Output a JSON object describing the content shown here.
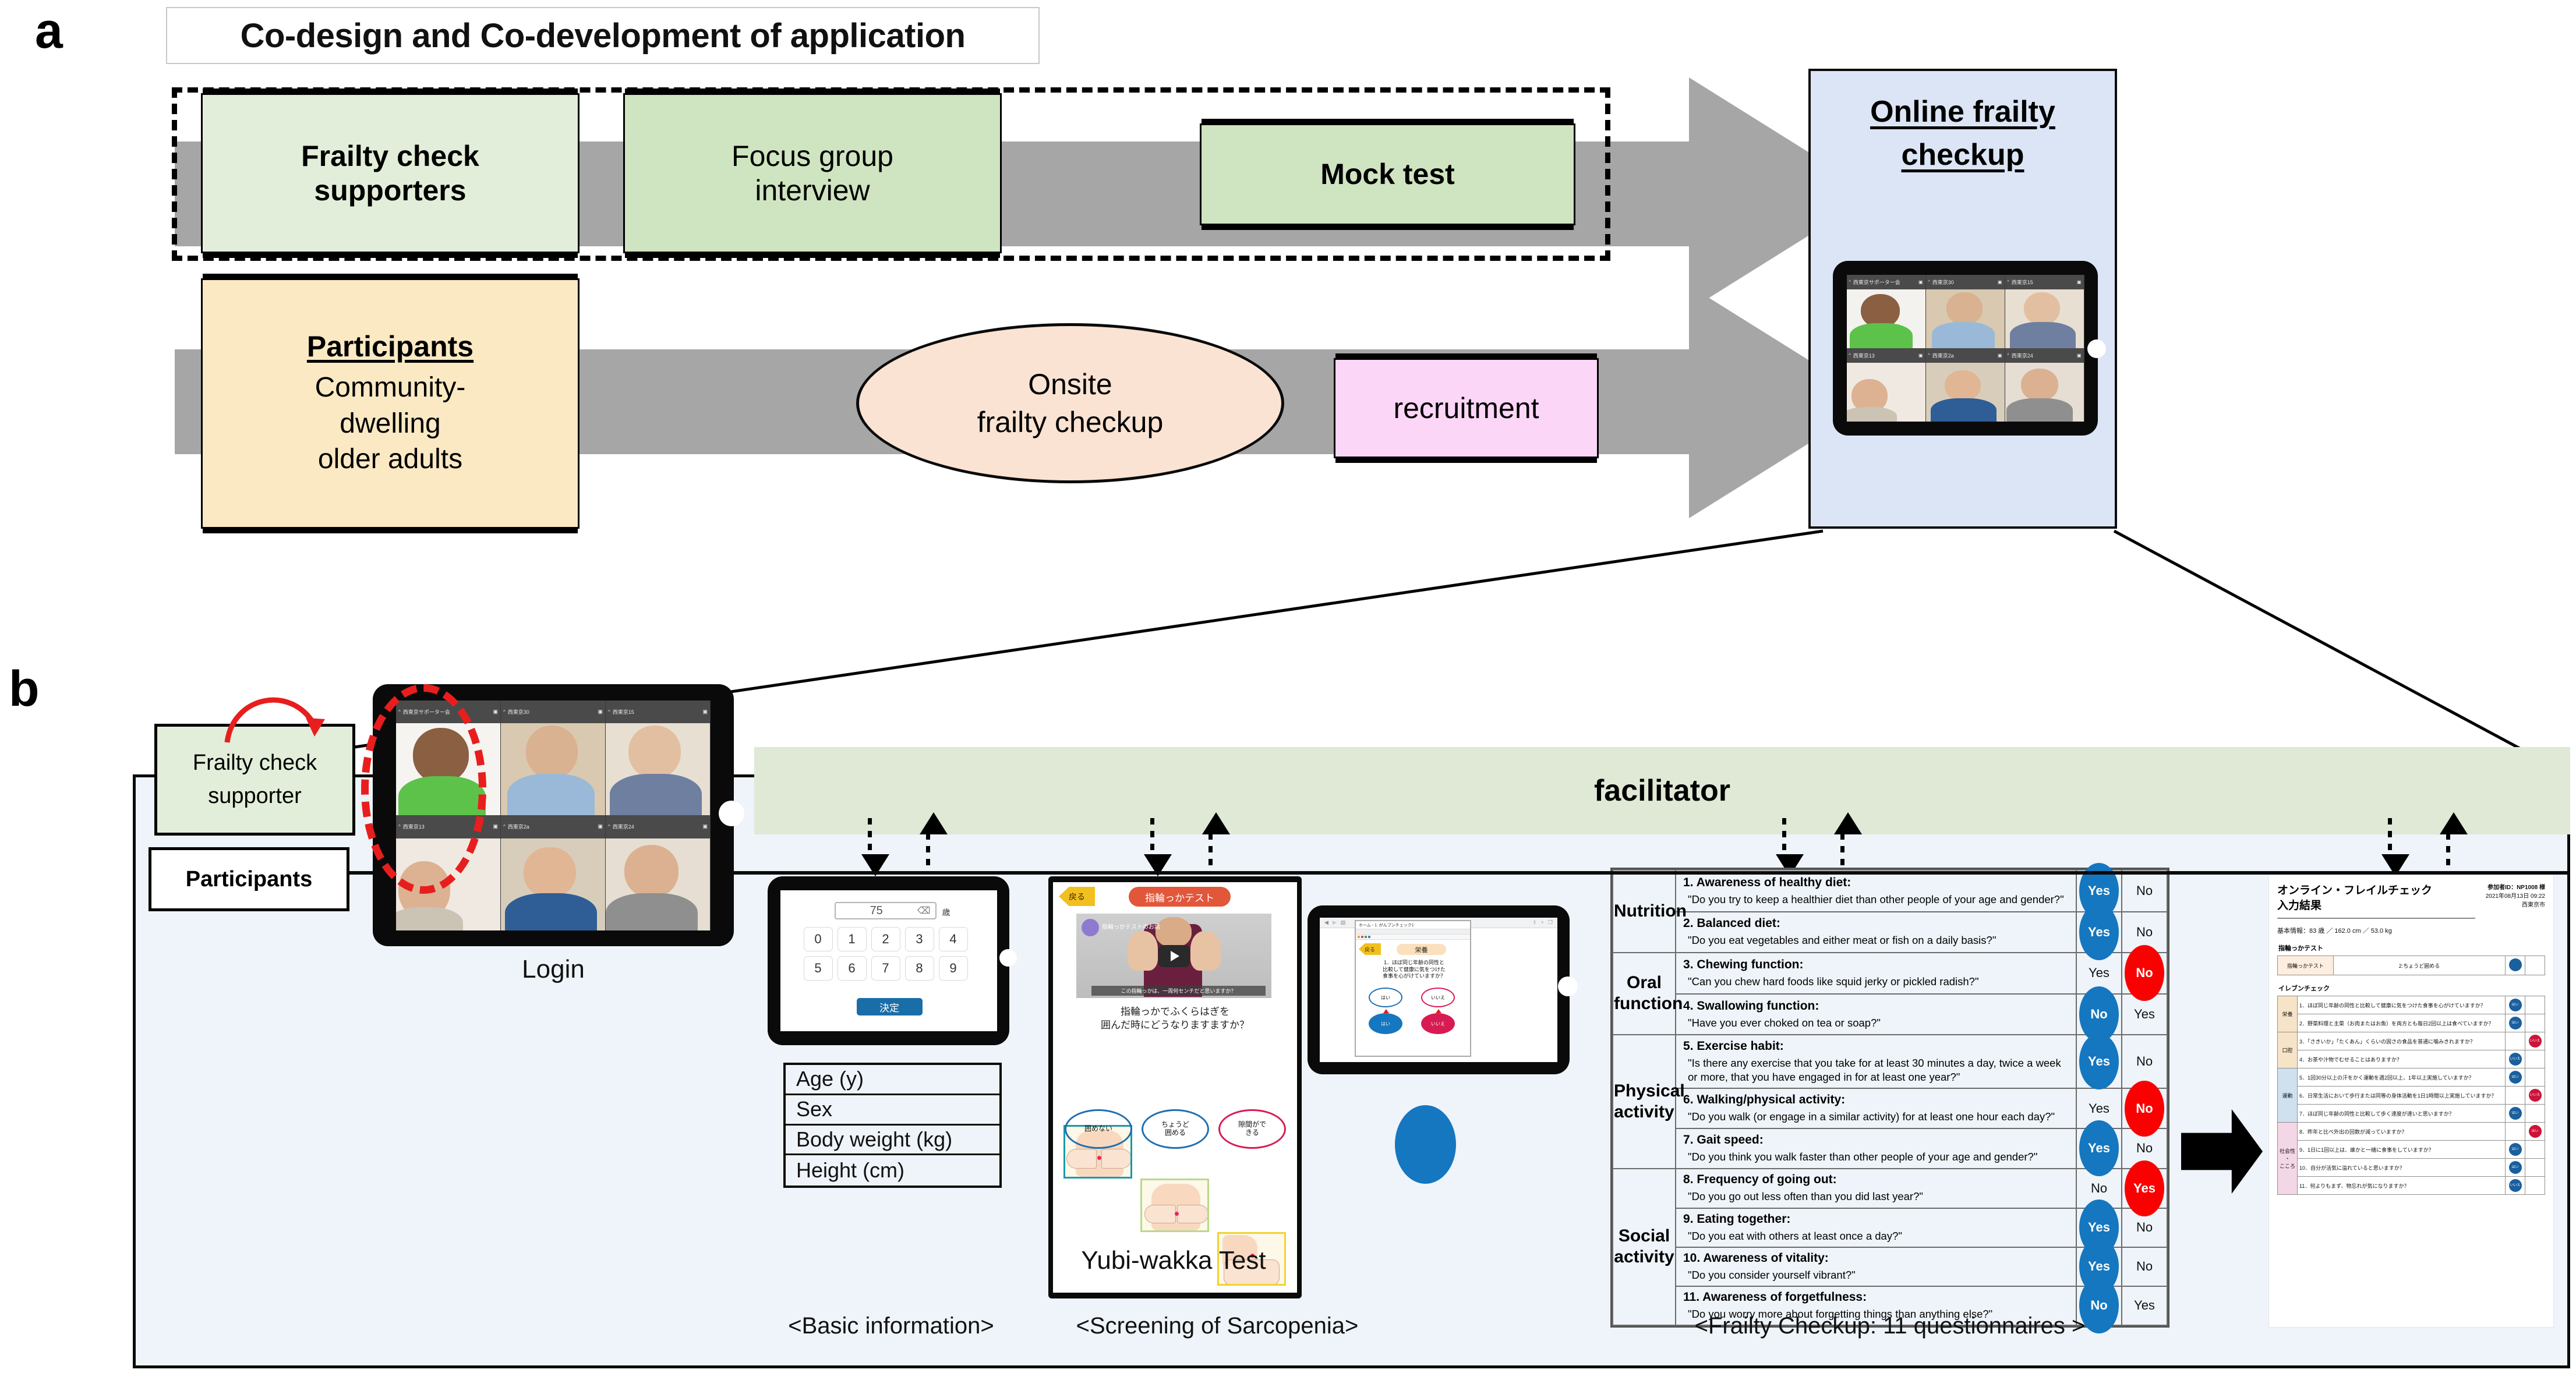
{
  "panels": {
    "a_letter": "a",
    "b_letter": "b"
  },
  "panel_a": {
    "title": "Co-design and Co-development of application",
    "supporter_track": [
      {
        "label": "Frailty check\nsupporters",
        "bold": true,
        "fill": "#e2eed9"
      },
      {
        "label": "Focus group\ninterview",
        "bold": false,
        "fill": "#cfe4c0"
      },
      {
        "label": "Mock test",
        "bold": true,
        "fill": "#cfe4c0"
      }
    ],
    "participant_track": {
      "box_title": "Participants",
      "box_sub": "Community-\ndwelling\nolder adults",
      "box_fill": "#fbe9c3",
      "oval_label": "Onsite\nfrailty checkup",
      "oval_fill": "#fae3d3",
      "recruitment_label": "recruitment",
      "recruitment_fill": "#fcd6f7"
    },
    "outcome": {
      "title": "Online frailty\ncheckup",
      "fill": "#dbe5f5"
    }
  },
  "panel_b": {
    "facilitator_label": "facilitator",
    "supporter_tag": "Frailty check\nsupporter",
    "participants_tag": "Participants",
    "stages": [
      {
        "name": "login",
        "label": "Login",
        "caption": ""
      },
      {
        "name": "basic-info",
        "label": "",
        "caption": "<Basic information>"
      },
      {
        "name": "yubi-wakka",
        "label": "Yubi-wakka  Test",
        "caption": "<Screening of Sarcopenia>"
      },
      {
        "name": "frailty-q",
        "label": "",
        "caption": "<Frailty Checkup: 11 questionnaires >"
      }
    ],
    "basic_info_rows": [
      "Age (y)",
      "Sex",
      "Body weight (kg)",
      "Height (cm)"
    ],
    "keypad": {
      "value": "75",
      "unit": "歳",
      "keys": [
        "0",
        "1",
        "2",
        "3",
        "4",
        "5",
        "6",
        "7",
        "8",
        "9"
      ],
      "submit": "決定",
      "backspace_icon": "backspace-icon"
    },
    "yubi_wakka_screen": {
      "back_label": "戻る",
      "pill_label": "指輪っかテスト",
      "video_caption": "この指輪っかは、一周何センチだと思いますか？",
      "video_overlay_title": "指輪っかテストのお話",
      "question": "指輪っかでふくらはぎを\n囲んだ時にどうなりますますか？",
      "options": [
        {
          "label": "囲めない",
          "color": "#1f6fb2",
          "img_border": "#1a9aa8"
        },
        {
          "label": "ちょうど\n囲める",
          "color": "#1f6fb2",
          "img_border": "#b8d98a"
        },
        {
          "label": "隙間がで\nきる",
          "color": "#d81b52",
          "img_border": "#f2d231"
        }
      ],
      "play_icon": "play-button-icon"
    },
    "nutrition_screen": {
      "tab_title": "ホーム - 1. がんプンチェック1",
      "back_label": "戻る",
      "pill_label": "栄養",
      "question": "1．ほぼ同じ年齢の同性と\n比較して健康に気をつけた\n食事を心がけていますか？",
      "options_outline": [
        {
          "label": "はい",
          "color": "#1f6fb2"
        },
        {
          "label": "いいえ",
          "color": "#d81b52"
        }
      ],
      "options_filled": [
        {
          "label": "はい",
          "color": "#1577bf"
        },
        {
          "label": "いいえ",
          "color": "#d81b52"
        }
      ]
    },
    "zoom_tile_names": [
      "西東京サポーター会",
      "西東京30",
      "西東京15",
      "西東京13",
      "西東京2a",
      "西東京24"
    ],
    "questionnaire": {
      "domains": [
        {
          "name": "Nutrition",
          "rows": 2,
          "items": [
            {
              "n": "1",
              "title": "Awareness of healthy diet:",
              "text": "\"Do you try to keep a healthier diet than other people of your age and gender?\"",
              "left": "Yes",
              "right": "No",
              "selected": "left",
              "selected_color": "blue"
            },
            {
              "n": "2",
              "title": "Balanced diet:",
              "text": "\"Do you eat vegetables and either meat or fish on a daily basis?\"",
              "left": "Yes",
              "right": "No",
              "selected": "left",
              "selected_color": "blue"
            }
          ]
        },
        {
          "name": "Oral function",
          "rows": 2,
          "items": [
            {
              "n": "3",
              "title": "Chewing function:",
              "text": "\"Can you chew hard foods like squid jerky or pickled radish?\"",
              "left": "Yes",
              "right": "No",
              "selected": "right",
              "selected_color": "red"
            },
            {
              "n": "4",
              "title": "Swallowing function:",
              "text": "\"Have you ever choked on tea or soap?\"",
              "left": "No",
              "right": "Yes",
              "selected": "left",
              "selected_color": "blue"
            }
          ]
        },
        {
          "name": "Physical\nactivity",
          "rows": 3,
          "items": [
            {
              "n": "5",
              "title": "Exercise habit:",
              "text": "\"Is there any exercise that you take for at least 30 minutes a day, twice a week or more, that you have engaged in for at least one year?\"",
              "left": "Yes",
              "right": "No",
              "selected": "left",
              "selected_color": "blue"
            },
            {
              "n": "6",
              "title": "Walking/physical activity:",
              "text": "\"Do you walk (or engage in a similar activity) for at least one hour each day?\"",
              "left": "Yes",
              "right": "No",
              "selected": "right",
              "selected_color": "red"
            },
            {
              "n": "7",
              "title": "Gait speed:",
              "text": "\"Do you think you walk faster than other people of your age and gender?\"",
              "left": "Yes",
              "right": "No",
              "selected": "left",
              "selected_color": "blue"
            }
          ]
        },
        {
          "name": "Social\nactivity",
          "rows": 4,
          "items": [
            {
              "n": "8",
              "title": "Frequency of going out:",
              "text": "\"Do you go out less often than you did last year?\"",
              "left": "No",
              "right": "Yes",
              "selected": "right",
              "selected_color": "red"
            },
            {
              "n": "9",
              "title": "Eating together:",
              "text": "\"Do you eat with others at least once a day?\"",
              "left": "Yes",
              "right": "No",
              "selected": "left",
              "selected_color": "blue"
            },
            {
              "n": "10",
              "title": "Awareness of vitality:",
              "text": "\"Do you consider yourself vibrant?\"",
              "left": "Yes",
              "right": "No",
              "selected": "left",
              "selected_color": "blue"
            },
            {
              "n": "11",
              "title": "Awareness of forgetfulness:",
              "text": "\"Do you worry more about forgetting things than anything else?\"",
              "left": "No",
              "right": "Yes",
              "selected": "left",
              "selected_color": "blue"
            }
          ]
        }
      ]
    },
    "result_sheet": {
      "title": "オンライン・フレイルチェック\n入力結果",
      "participant_id": "参加者ID：NP1008 様",
      "datetime": "2021年08月13日 09:22",
      "place": "西東京市",
      "basic": "基本情報：83 歳 ／ 162.0 cm ／ 53.0 kg",
      "section1_title": "指輪っかテスト",
      "yubi_row": {
        "label": "指輪っかテスト",
        "value": "2:ちょうど囲める",
        "mark": "✓",
        "mark_color": "blue"
      },
      "section2_title": "イレブンチェック",
      "categories": [
        {
          "label": "栄養",
          "fill": "#f7e4c8",
          "span": 2
        },
        {
          "label": "口腔",
          "fill": "#f7e4c8",
          "span": 2
        },
        {
          "label": "運動",
          "fill": "#cfe0ef",
          "span": 3
        },
        {
          "label": "社会性\n・\nこころ",
          "fill": "#f4d7e6",
          "span": 4
        }
      ],
      "rows": [
        {
          "n": "1",
          "text": "ほぼ同じ年齢の同性と比較して健康に気をつけた食事を心がけていますか？",
          "mark": "はい",
          "side": "left",
          "color": "blue"
        },
        {
          "n": "2",
          "text": "野菜料理と主菜（お肉またはお魚）を両方とも毎日2回以上は食べていますか？",
          "mark": "はい",
          "side": "left",
          "color": "blue"
        },
        {
          "n": "3",
          "text": "「さきいか」「たくあん」くらいの固さの食品を普通に噛みきれますか？",
          "mark": "いいえ",
          "side": "right",
          "color": "red"
        },
        {
          "n": "4",
          "text": "お茶や汁物でむせることはありますか？",
          "mark": "いいえ",
          "side": "left",
          "color": "blue"
        },
        {
          "n": "5",
          "text": "1回30分以上の汗をかく運動を週2回以上、1年以上実施していますか？",
          "mark": "はい",
          "side": "left",
          "color": "blue"
        },
        {
          "n": "6",
          "text": "日常生活において歩行または同等の身体活動を1日1時間以上実施していますか？",
          "mark": "いいえ",
          "side": "right",
          "color": "red"
        },
        {
          "n": "7",
          "text": "ほぼ同じ年齢の同性と比較して歩く速度が速いと思いますか？",
          "mark": "はい",
          "side": "left",
          "color": "blue"
        },
        {
          "n": "8",
          "text": "昨年と比べ外出の回数が減っていますか？",
          "mark": "はい",
          "side": "right",
          "color": "red"
        },
        {
          "n": "9",
          "text": "1日に1回以上は、誰かと一緒に食事をしていますか？",
          "mark": "はい",
          "side": "left",
          "color": "blue"
        },
        {
          "n": "10",
          "text": "自分が活気に溢れていると思いますか？",
          "mark": "はい",
          "side": "left",
          "color": "blue"
        },
        {
          "n": "11",
          "text": "何よりもまず、物忘れが気になりますか？",
          "mark": "いいえ",
          "side": "left",
          "color": "blue"
        }
      ]
    }
  },
  "colors": {
    "accent_blue": "#1577bf",
    "accent_red": "#fb0000",
    "gray_arrow": "#a6a6a6",
    "panel_b_bg": "#eef4f9",
    "facilitator_green": "#dfe9d6"
  }
}
